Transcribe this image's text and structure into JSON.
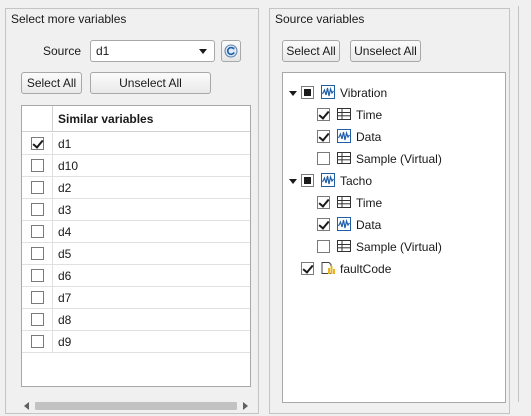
{
  "left_panel": {
    "title": "Select more variables",
    "source_label": "Source",
    "source_value": "d1",
    "select_all": "Select All",
    "unselect_all": "Unselect All",
    "table": {
      "header": "Similar variables",
      "rows": [
        {
          "name": "d1",
          "checked": true
        },
        {
          "name": "d10",
          "checked": false
        },
        {
          "name": "d2",
          "checked": false
        },
        {
          "name": "d3",
          "checked": false
        },
        {
          "name": "d4",
          "checked": false
        },
        {
          "name": "d5",
          "checked": false
        },
        {
          "name": "d6",
          "checked": false
        },
        {
          "name": "d7",
          "checked": false
        },
        {
          "name": "d8",
          "checked": false
        },
        {
          "name": "d9",
          "checked": false
        }
      ]
    }
  },
  "right_panel": {
    "title": "Source variables",
    "select_all": "Select All",
    "unselect_all": "Unselect All",
    "tree": [
      {
        "label": "Vibration",
        "state": "mixed",
        "icon": "signal-icon",
        "expanded": true,
        "level": 0,
        "children": [
          {
            "label": "Time",
            "state": "checked",
            "icon": "table-icon"
          },
          {
            "label": "Data",
            "state": "checked",
            "icon": "signal-icon"
          },
          {
            "label": "Sample (Virtual)",
            "state": "unchecked",
            "icon": "table-icon"
          }
        ]
      },
      {
        "label": "Tacho",
        "state": "mixed",
        "icon": "signal-icon",
        "expanded": true,
        "level": 0,
        "children": [
          {
            "label": "Time",
            "state": "checked",
            "icon": "table-icon"
          },
          {
            "label": "Data",
            "state": "checked",
            "icon": "signal-icon"
          },
          {
            "label": "Sample (Virtual)",
            "state": "unchecked",
            "icon": "table-icon"
          }
        ]
      },
      {
        "label": "faultCode",
        "state": "checked",
        "icon": "folder-data-icon",
        "expanded": false,
        "level": 0,
        "children": []
      }
    ]
  },
  "colors": {
    "panel_bg": "#f0f0f0",
    "border": "#a8a8a8",
    "icon_blue": "#1f5fa8",
    "icon_yellow": "#e8b320"
  }
}
